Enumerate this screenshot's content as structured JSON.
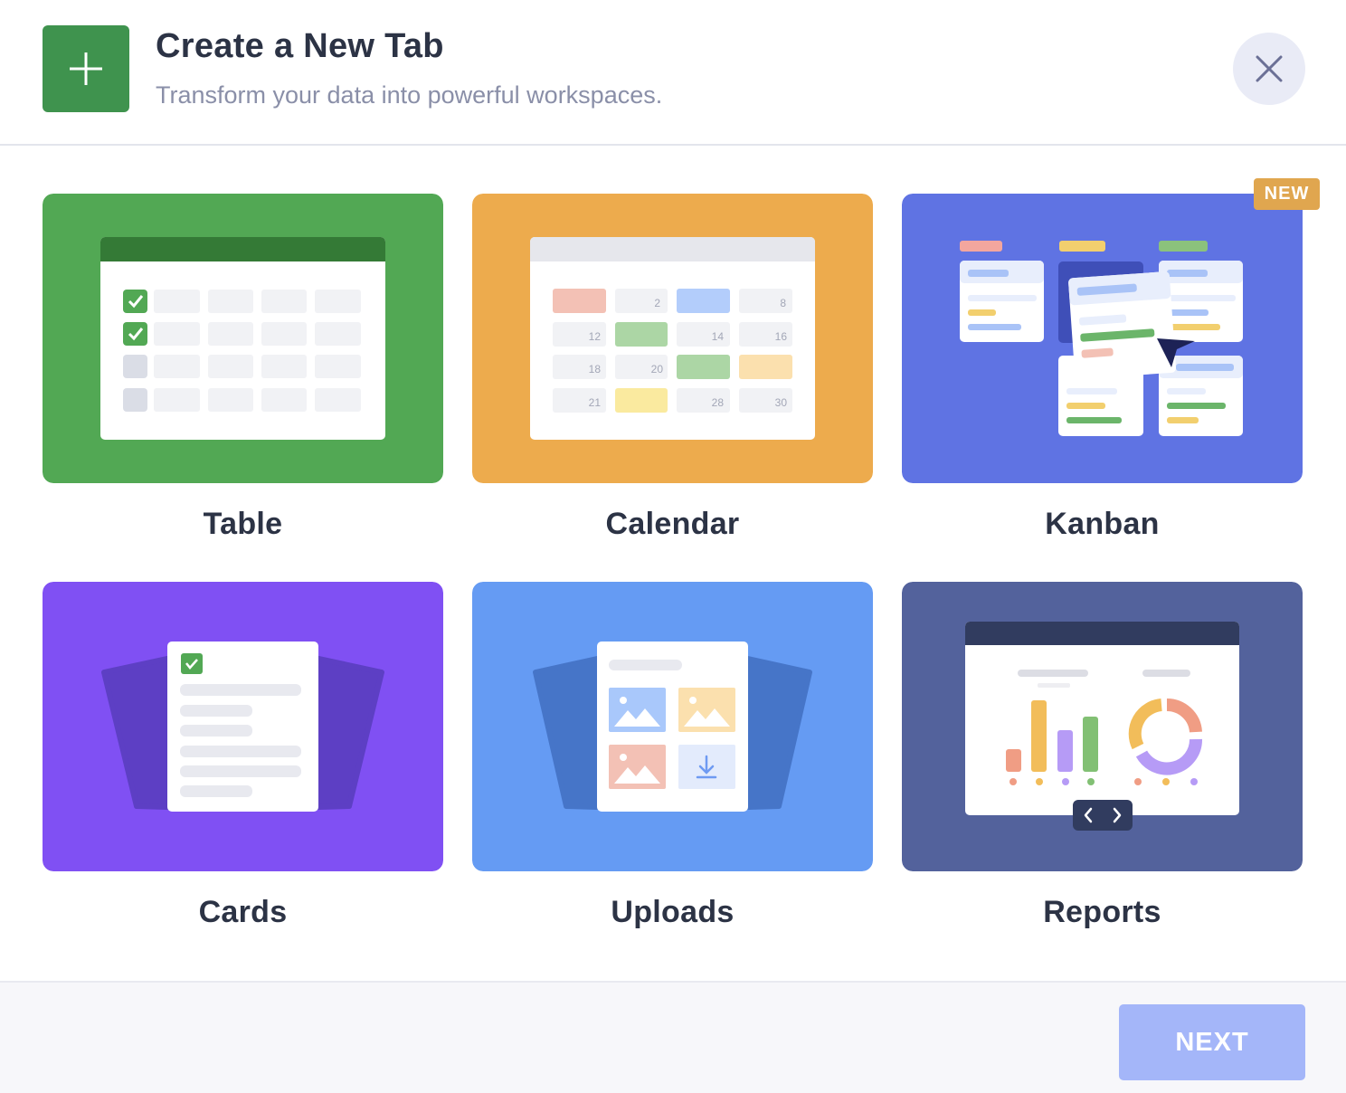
{
  "header": {
    "title": "Create a New Tab",
    "subtitle": "Transform your data into powerful workspaces.",
    "icon": "plus-icon",
    "close_icon": "close-icon"
  },
  "tiles": [
    {
      "label": "Table",
      "color": "#52a854"
    },
    {
      "label": "Calendar",
      "color": "#edab4d"
    },
    {
      "label": "Kanban",
      "color": "#5f73e3",
      "badge": "NEW"
    },
    {
      "label": "Cards",
      "color": "#8050f3"
    },
    {
      "label": "Uploads",
      "color": "#659bf3"
    },
    {
      "label": "Reports",
      "color": "#53629c"
    }
  ],
  "calendar_days": [
    "2",
    "8",
    "12",
    "14",
    "16",
    "18",
    "20",
    "21",
    "28",
    "30"
  ],
  "footer": {
    "next_label": "NEXT",
    "next_color": "#a4b6f9"
  }
}
